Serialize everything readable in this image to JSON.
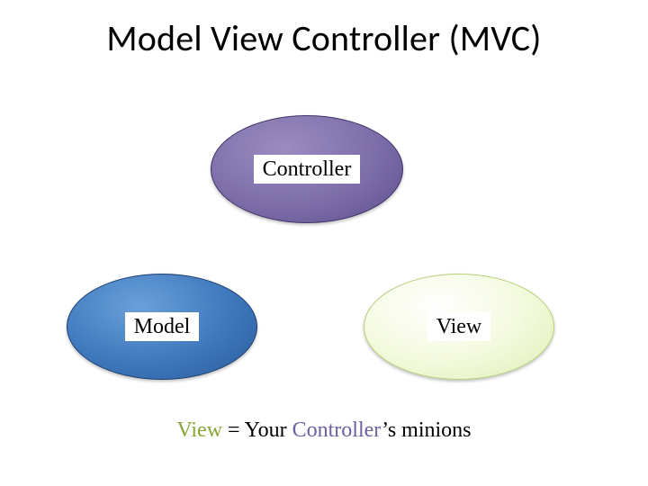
{
  "title": "Model View Controller (MVC)",
  "nodes": {
    "controller": {
      "label": "Controller"
    },
    "model": {
      "label": "Model"
    },
    "view": {
      "label": "View"
    }
  },
  "caption": {
    "view_word": "View",
    "mid1": " = Your ",
    "controller_word": "Controller",
    "tail": "’s minions"
  },
  "colors": {
    "controller": "#6f5fa0",
    "model": "#3f78bd",
    "view": "#8aa636"
  }
}
